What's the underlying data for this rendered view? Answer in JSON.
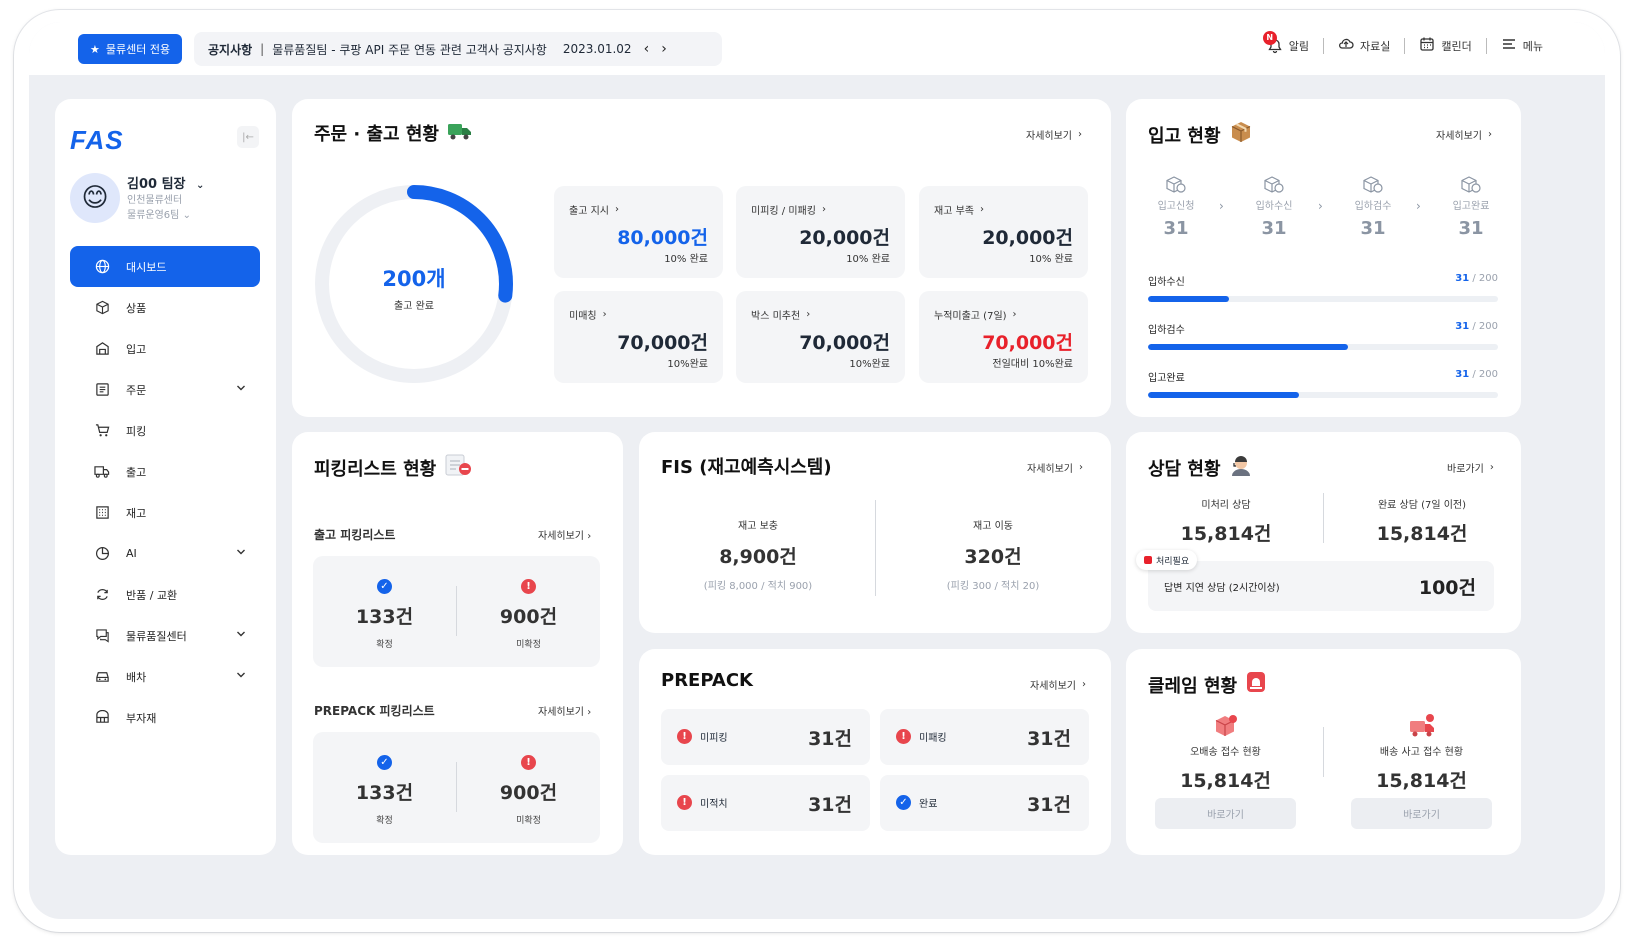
{
  "topbar": {
    "center_badge": "물류센터 전용",
    "notice_label": "공지사항",
    "notice_sep": "|",
    "notice_text": "물류품질팀 - 쿠팡 API 주문 연동 관련 고객사 공지사항",
    "notice_date": "2023.01.02",
    "notif_badge": "N",
    "tools": {
      "alarm": "알림",
      "files": "자료실",
      "calendar": "캘린더",
      "menu": "메뉴"
    }
  },
  "sidebar": {
    "logo": "FAS",
    "user_name": "김00 팀장",
    "user_center": "인천물류센터",
    "user_team": "물류운영6팀",
    "items": [
      {
        "label": "대시보드",
        "icon": "globe-icon",
        "active": true
      },
      {
        "label": "상품",
        "icon": "box-icon"
      },
      {
        "label": "입고",
        "icon": "warehouse-icon"
      },
      {
        "label": "주문",
        "icon": "order-icon",
        "expand": true
      },
      {
        "label": "피킹",
        "icon": "cart-icon"
      },
      {
        "label": "출고",
        "icon": "truck-icon"
      },
      {
        "label": "재고",
        "icon": "grid-icon"
      },
      {
        "label": "AI",
        "icon": "pie-icon",
        "expand": true
      },
      {
        "label": "반품 / 교환",
        "icon": "return-icon"
      },
      {
        "label": "물류품질센터",
        "icon": "chat-icon",
        "expand": true
      },
      {
        "label": "배차",
        "icon": "car-icon",
        "expand": true
      },
      {
        "label": "부자재",
        "icon": "material-icon"
      }
    ]
  },
  "orders": {
    "title": "주문 · 출고 현황",
    "more": "자세히보기",
    "donut_value": "200개",
    "donut_label": "출고 완료",
    "donut_progress": 0.27,
    "stats": [
      {
        "label": "출고 지시",
        "value": "80,000건",
        "sub": "10% 완료",
        "color": "blue"
      },
      {
        "label": "미피킹 / 미패킹",
        "value": "20,000건",
        "sub": "10% 완료",
        "color": "dark"
      },
      {
        "label": "재고 부족",
        "value": "20,000건",
        "sub": "10% 완료",
        "color": "dark"
      },
      {
        "label": "미매칭",
        "value": "70,000건",
        "sub": "10%완료",
        "color": "dark"
      },
      {
        "label": "박스 미추천",
        "value": "70,000건",
        "sub": "10%완료",
        "color": "dark"
      },
      {
        "label": "누적미출고 (7일)",
        "value": "70,000건",
        "sub": "전일대비 10%완료",
        "color": "red"
      }
    ]
  },
  "inbound": {
    "title": "입고 현황",
    "more": "자세히보기",
    "steps": [
      {
        "label": "입고신청",
        "value": "31"
      },
      {
        "label": "입하수신",
        "value": "31"
      },
      {
        "label": "입하검수",
        "value": "31"
      },
      {
        "label": "입고완료",
        "value": "31"
      }
    ],
    "progress": [
      {
        "label": "입하수신",
        "current": "31",
        "total": "/ 200",
        "fraction": 0.23
      },
      {
        "label": "입하검수",
        "current": "31",
        "total": "/ 200",
        "fraction": 0.57
      },
      {
        "label": "입고완료",
        "current": "31",
        "total": "/ 200",
        "fraction": 0.43
      }
    ]
  },
  "picking": {
    "title": "피킹리스트 현황",
    "outbound": {
      "label": "출고 피킹리스트",
      "more": "자세히보기",
      "confirmed": "133건",
      "confirmed_label": "확정",
      "unconfirmed": "900건",
      "unconfirmed_label": "미확정"
    },
    "prepack": {
      "label": "PREPACK 피킹리스트",
      "more": "자세히보기",
      "confirmed": "133건",
      "confirmed_label": "확정",
      "unconfirmed": "900건",
      "unconfirmed_label": "미확정"
    }
  },
  "fis": {
    "title": "FIS (재고예측시스템)",
    "more": "자세히보기",
    "left": {
      "label": "재고 보충",
      "value": "8,900건",
      "sub": "(피킹 8,000 / 적치 900)"
    },
    "right": {
      "label": "재고 이동",
      "value": "320건",
      "sub": "(피킹 300 / 적치 20)"
    }
  },
  "prepack": {
    "title": "PREPACK",
    "more": "자세히보기",
    "items": [
      {
        "label": "미피킹",
        "value": "31건",
        "status": "warn"
      },
      {
        "label": "미패킹",
        "value": "31건",
        "status": "warn"
      },
      {
        "label": "미적치",
        "value": "31건",
        "status": "warn"
      },
      {
        "label": "완료",
        "value": "31건",
        "status": "done"
      }
    ]
  },
  "consult": {
    "title": "상담 현황",
    "more": "바로가기",
    "pending_label": "미처리 상담",
    "pending_value": "15,814건",
    "done_label": "완료 상담 (7일 이전)",
    "done_value": "15,814건",
    "tag": "처리필요",
    "delay_label": "답변 지연 상담 (2시간이상)",
    "delay_value": "100건"
  },
  "claim": {
    "title": "클레임 현황",
    "left_label": "오배송 접수 현황",
    "left_value": "15,814건",
    "left_btn": "바로가기",
    "right_label": "배송 사고 접수 현황",
    "right_value": "15,814건",
    "right_btn": "바로가기"
  },
  "colors": {
    "accent": "#1463ea",
    "danger": "#e8212b",
    "background": "#edeff3"
  }
}
